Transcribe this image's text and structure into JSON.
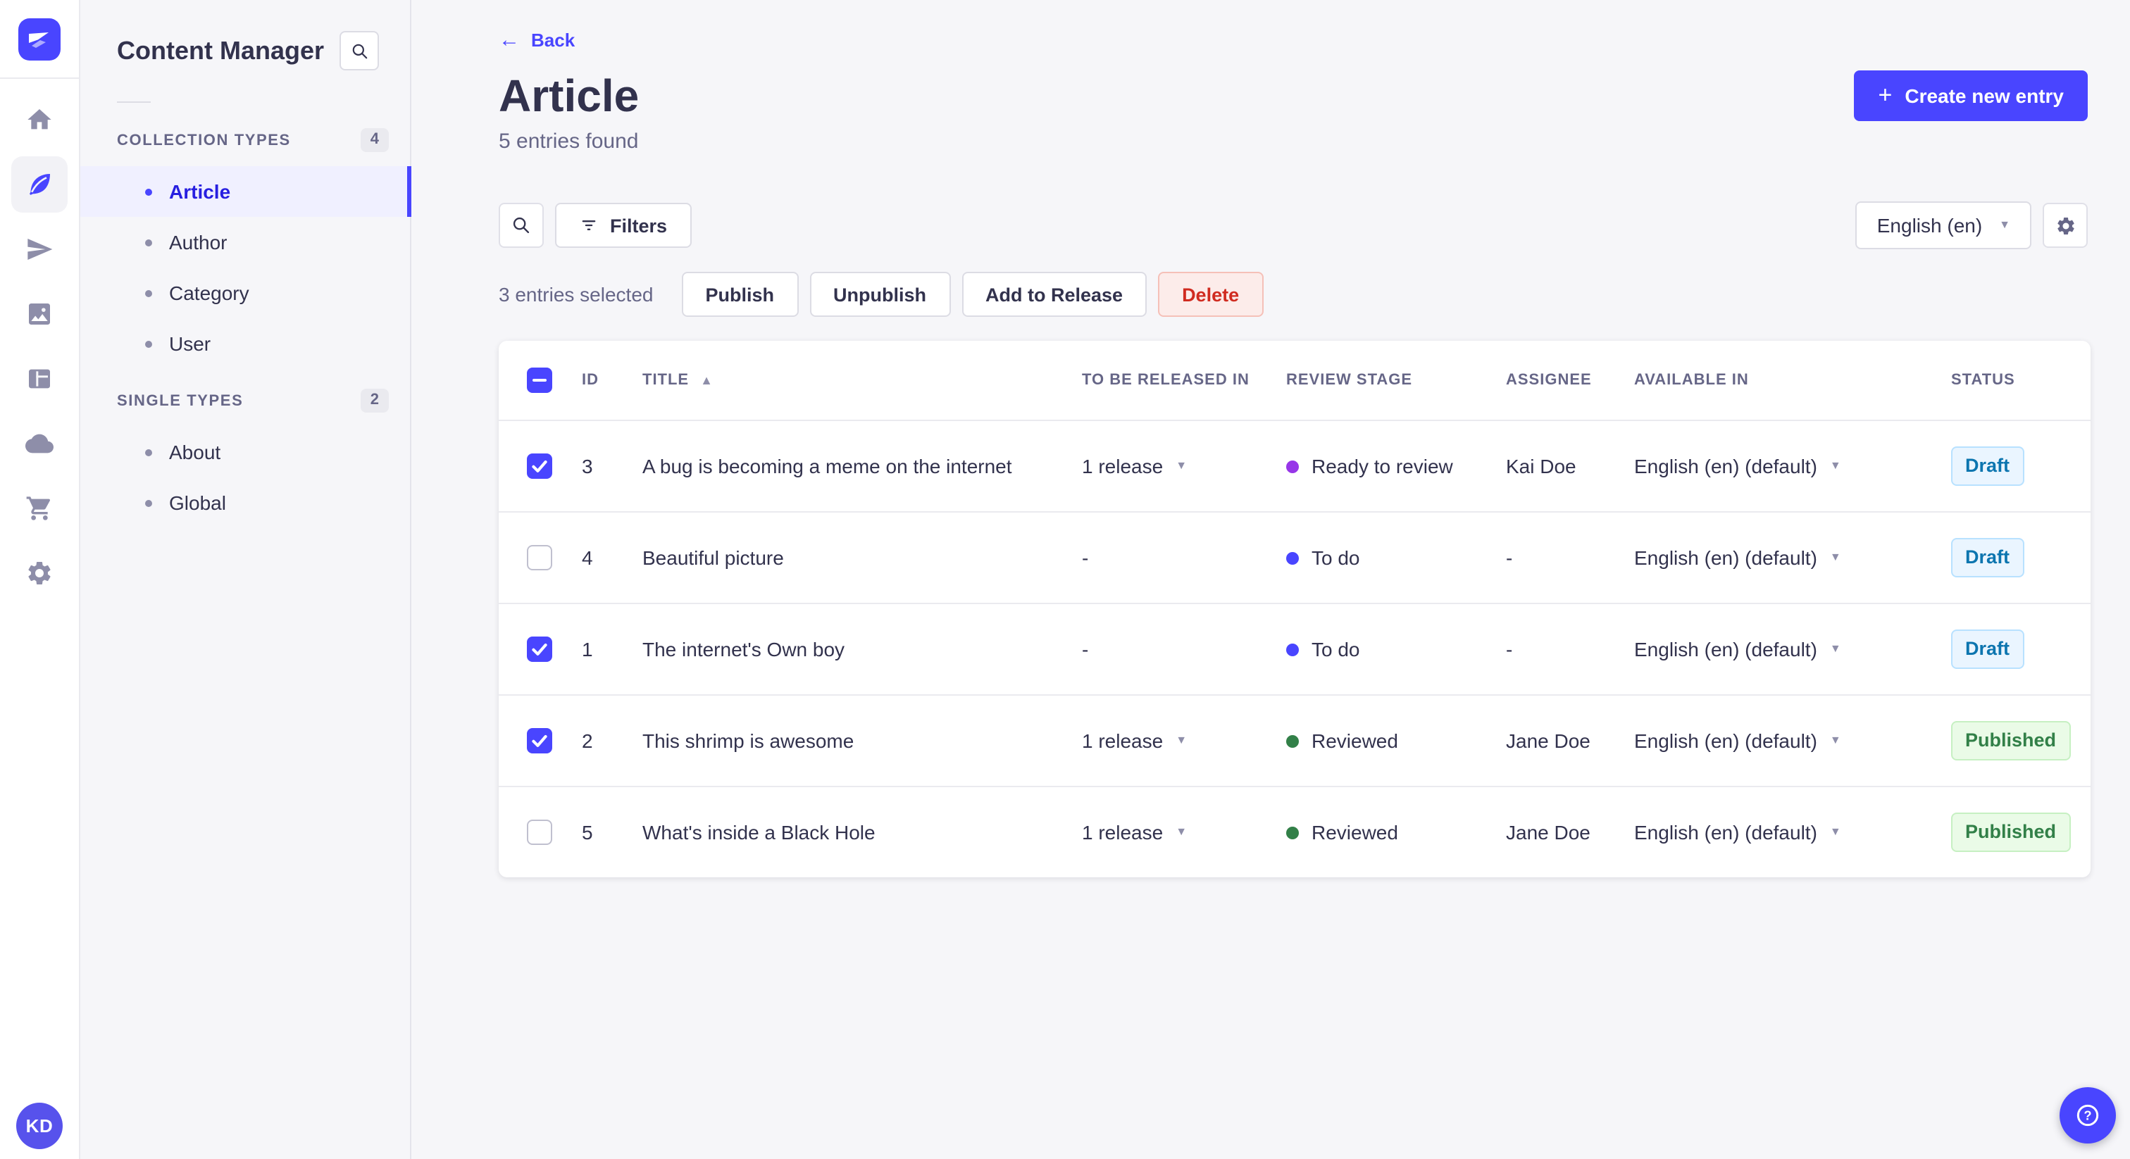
{
  "colors": {
    "primary": "#4945ff",
    "active_item_bg": "#f0f0ff",
    "active_item_text": "#271fe0",
    "draft_bg": "#eaf5ff",
    "draft_text": "#0c75af",
    "published_bg": "#eafbe7",
    "published_text": "#328048",
    "danger_bg": "#fcecea",
    "danger_text": "#d02b20",
    "stage_ready_to_review_dot": "#9736e8",
    "stage_to_do_dot": "#4945ff",
    "stage_reviewed_dot": "#328048"
  },
  "nav_rail": {
    "logo_icon": "strapi-logo-icon",
    "icons": [
      "home-icon",
      "content-manager-icon",
      "releases-icon",
      "media-library-icon",
      "content-type-builder-icon",
      "deploy-icon",
      "marketplace-icon",
      "settings-icon"
    ],
    "active_icon": "content-manager-icon",
    "avatar_initials": "KD"
  },
  "subnav": {
    "title": "Content Manager",
    "search_icon": "search-icon",
    "sections": [
      {
        "label": "COLLECTION TYPES",
        "count": "4",
        "items": [
          {
            "label": "Article",
            "active": true
          },
          {
            "label": "Author",
            "active": false
          },
          {
            "label": "Category",
            "active": false
          },
          {
            "label": "User",
            "active": false
          }
        ]
      },
      {
        "label": "SINGLE TYPES",
        "count": "2",
        "items": [
          {
            "label": "About",
            "active": false
          },
          {
            "label": "Global",
            "active": false
          }
        ]
      }
    ]
  },
  "header": {
    "back_label": "Back",
    "title": "Article",
    "subtitle": "5 entries found",
    "create_button_label": "Create new entry"
  },
  "toolbar": {
    "search_icon": "search-icon",
    "filters_label": "Filters",
    "locale_value": "English (en)",
    "settings_icon": "gear-icon"
  },
  "selection": {
    "text": "3 entries selected",
    "publish": "Publish",
    "unpublish": "Unpublish",
    "add_to_release": "Add to Release",
    "delete": "Delete"
  },
  "table": {
    "headers": {
      "id": "ID",
      "title": "TITLE",
      "to_be_released_in": "TO BE RELEASED IN",
      "review_stage": "REVIEW STAGE",
      "assignee": "ASSIGNEE",
      "available_in": "AVAILABLE IN",
      "status": "STATUS"
    },
    "sort": {
      "column": "TITLE",
      "direction": "ascending"
    },
    "rows": [
      {
        "selected": true,
        "id": "3",
        "title": "A bug is becoming a meme on the internet",
        "release": "1 release",
        "review_stage": "Ready to review",
        "assignee": "Kai Doe",
        "available_in": "English (en) (default)",
        "status": "Draft"
      },
      {
        "selected": false,
        "id": "4",
        "title": "Beautiful picture",
        "release": "-",
        "review_stage": "To do",
        "assignee": "-",
        "available_in": "English (en) (default)",
        "status": "Draft"
      },
      {
        "selected": true,
        "id": "1",
        "title": "The internet's Own boy",
        "release": "-",
        "review_stage": "To do",
        "assignee": "-",
        "available_in": "English (en) (default)",
        "status": "Draft"
      },
      {
        "selected": true,
        "id": "2",
        "title": "This shrimp is awesome",
        "release": "1 release",
        "review_stage": "Reviewed",
        "assignee": "Jane Doe",
        "available_in": "English (en) (default)",
        "status": "Published"
      },
      {
        "selected": false,
        "id": "5",
        "title": "What's inside a Black Hole",
        "release": "1 release",
        "review_stage": "Reviewed",
        "assignee": "Jane Doe",
        "available_in": "English (en) (default)",
        "status": "Published"
      }
    ]
  },
  "help": {
    "icon": "help-icon"
  }
}
